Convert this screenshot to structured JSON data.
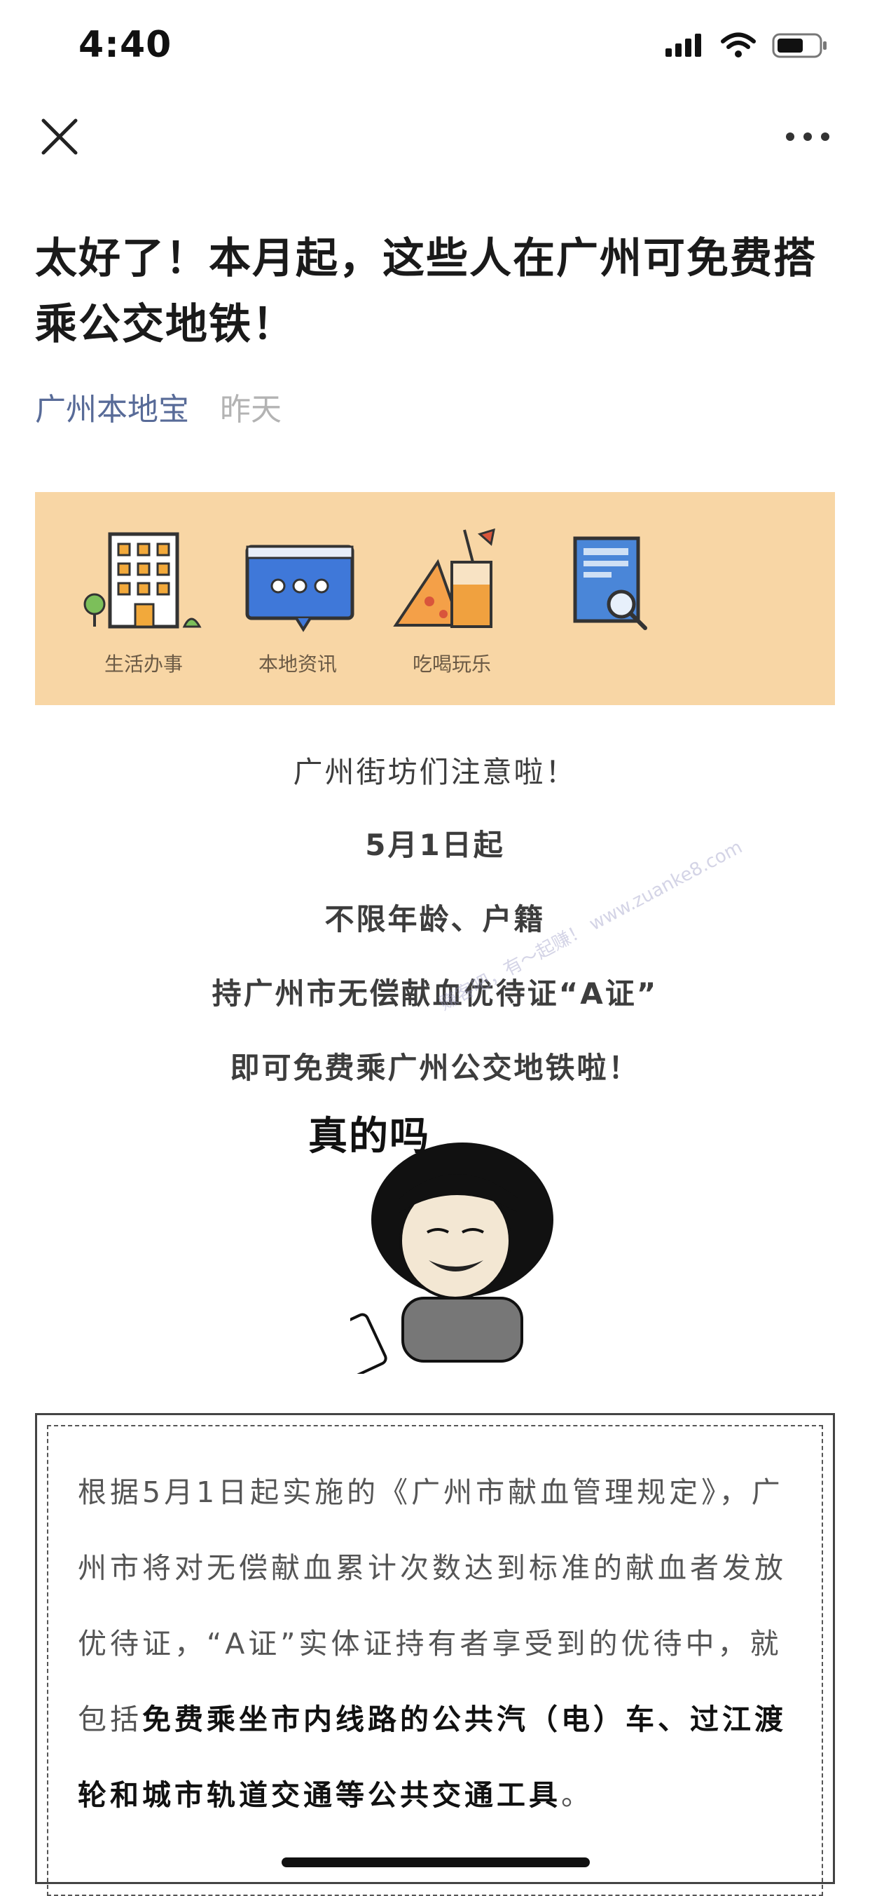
{
  "status_bar": {
    "time": "4:40"
  },
  "nav": {
    "close_icon": "close-icon",
    "more_icon": "more-icon"
  },
  "article": {
    "title": "太好了！本月起，这些人在广州可免费搭乘公交地铁！",
    "author": "广州本地宝",
    "time": "昨天"
  },
  "banner": {
    "items": [
      {
        "label": "生活办事",
        "icon": "building-icon"
      },
      {
        "label": "本地资讯",
        "icon": "chat-bubble-icon"
      },
      {
        "label": "吃喝玩乐",
        "icon": "drink-pizza-icon"
      },
      {
        "label": "",
        "icon": "document-search-icon"
      }
    ]
  },
  "intro": {
    "line1": "广州街坊们注意啦！",
    "line2": "5月1日起",
    "line3": "不限年龄、户籍",
    "line4": "持广州市无偿献血优待证“A证”",
    "line5": "即可免费乘广州公交地铁啦！"
  },
  "meme": {
    "caption": "真的吗"
  },
  "watermark": "赚客吧，有～起赚！ www.zuanke8.com",
  "quote": {
    "text_normal": "根据5月1日起实施的《广州市献血管理规定》，广州市将对无偿献血累计次数达到标准的献血者发放优待证，“A证”实体证持有者享受到的优待中，就包括",
    "text_bold": "免费乘坐市内线路的公共汽（电）车、过江渡轮和城市轨道交通等公共交通工具",
    "text_end": "。"
  }
}
